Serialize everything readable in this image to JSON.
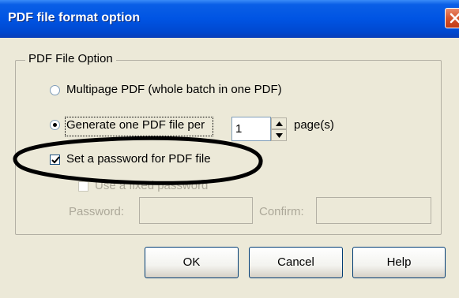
{
  "window": {
    "title": "PDF file format option"
  },
  "group": {
    "legend": "PDF File Option"
  },
  "options": {
    "multipage_label": "Multipage PDF (whole batch in one PDF)",
    "multipage_selected": false,
    "per_page_label": "Generate one PDF file per",
    "per_page_selected": true,
    "pages_value": "1",
    "pages_suffix": "page(s)",
    "password_checkbox_label": "Set a password for PDF file",
    "password_checked": true,
    "fixed_password_label": "Use a fixed password",
    "fixed_password_checked": false,
    "password_field_label": "Password:",
    "password_value": "",
    "confirm_field_label": "Confirm:",
    "confirm_value": ""
  },
  "buttons": {
    "ok": "OK",
    "cancel": "Cancel",
    "help": "Help"
  },
  "icons": {
    "close": "close-icon",
    "spin_up": "spin-up-arrow-icon",
    "spin_down": "spin-down-arrow-icon",
    "checkmark": "checkmark-icon"
  },
  "colors": {
    "titlebar": "#0054e3",
    "dialog_bg": "#ece9d8",
    "disabled_text": "#aca899"
  }
}
